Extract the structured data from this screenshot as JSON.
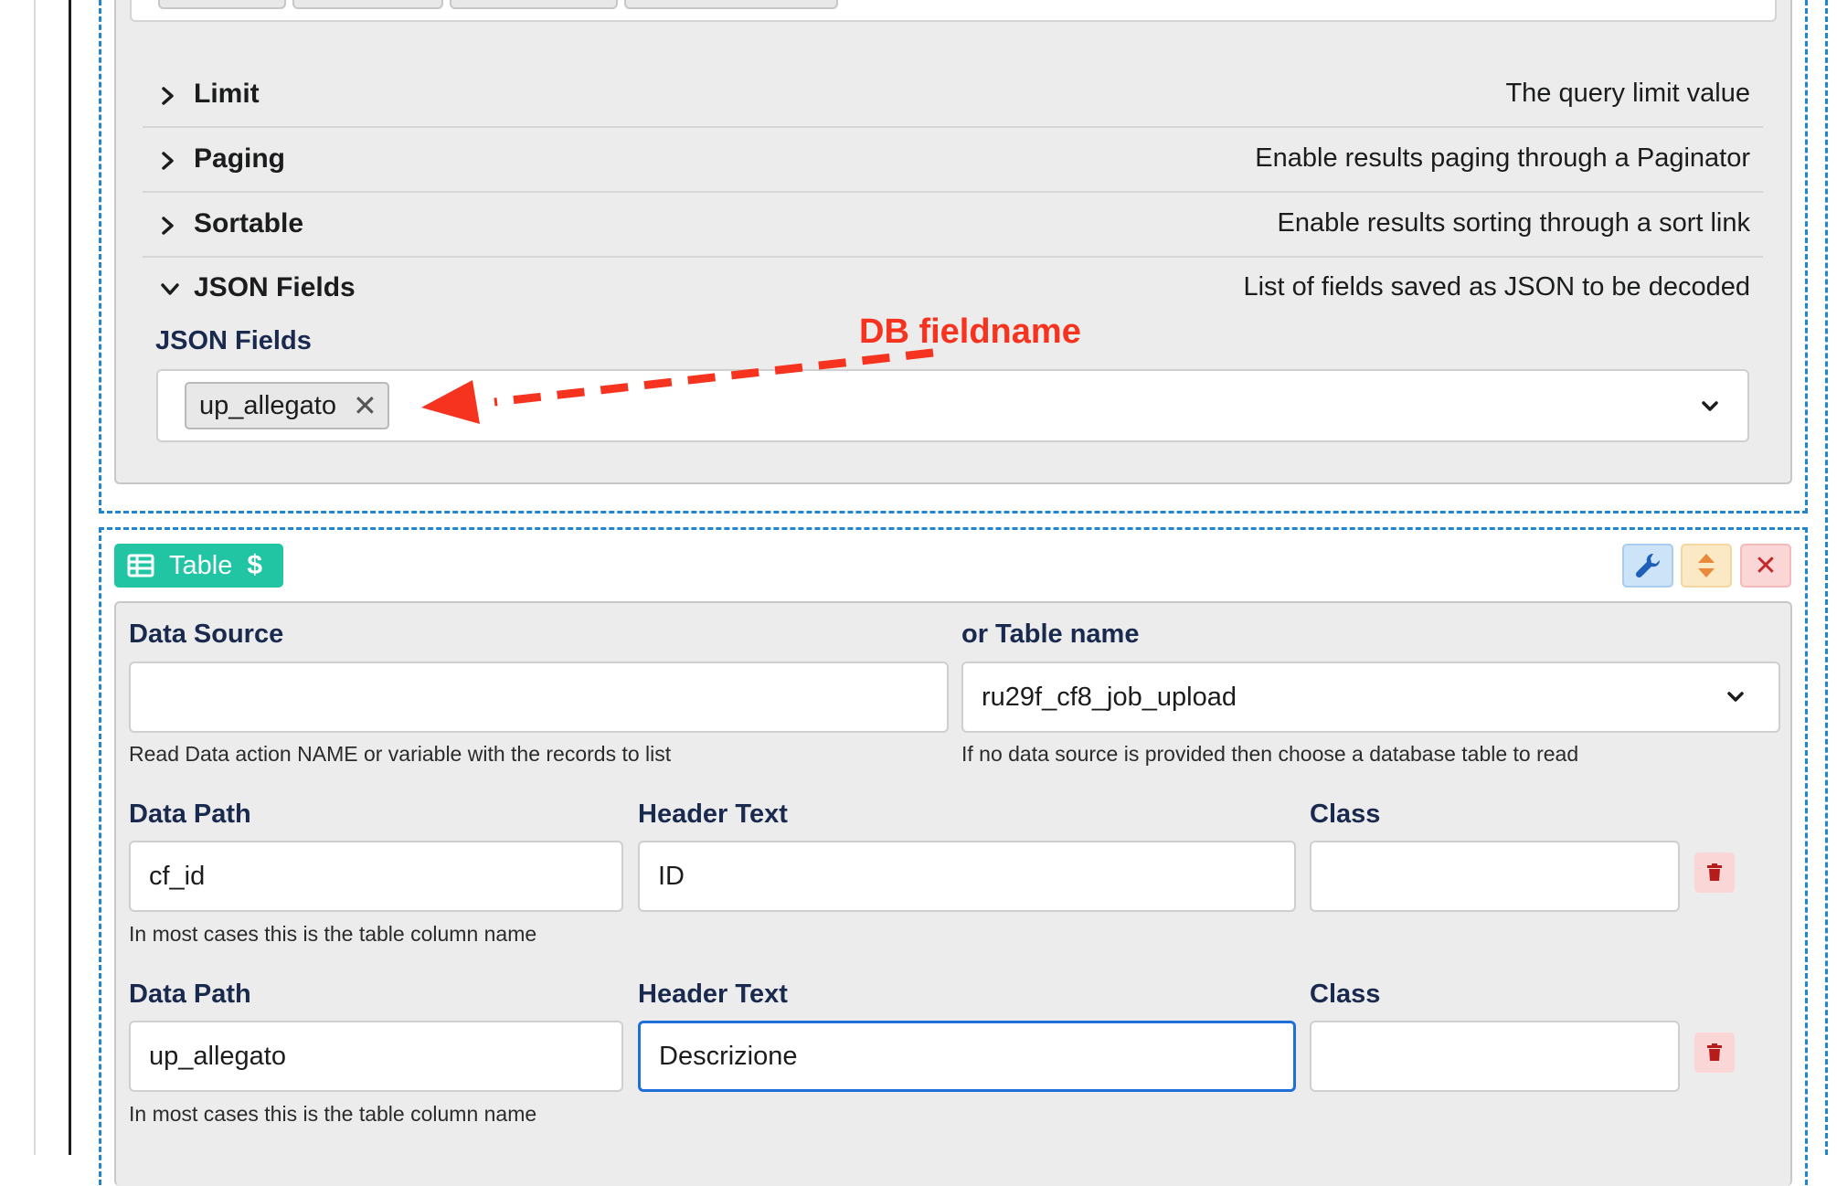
{
  "accordion": [
    {
      "title": "Limit",
      "description": "The query limit value",
      "state": "collapsed"
    },
    {
      "title": "Paging",
      "description": "Enable results paging through a Paginator",
      "state": "collapsed"
    },
    {
      "title": "Sortable",
      "description": "Enable results sorting through a sort link",
      "state": "collapsed"
    },
    {
      "title": "JSON Fields",
      "description": "List of fields saved as JSON to be decoded",
      "state": "expanded"
    }
  ],
  "json_fields": {
    "label": "JSON Fields",
    "chip": "up_allegato",
    "chip_remove_symbol": "✕"
  },
  "annotation": {
    "text": "DB fieldname",
    "color": "#f5331e"
  },
  "table_component": {
    "tag_label": "Table",
    "tag_symbol": "$",
    "close_symbol": "✕",
    "tag_color": "#21c5a4",
    "data_source": {
      "label": "Data Source",
      "value": "",
      "hint": "Read Data action NAME or variable with the records to list"
    },
    "table_name": {
      "label": "or Table name",
      "value": "ru29f_cf8_job_upload",
      "hint": "If no data source is provided then choose a database table to read"
    },
    "columns": [
      {
        "data_path_label": "Data Path",
        "data_path": "cf_id",
        "header_label": "Header Text",
        "header": "ID",
        "class_label": "Class",
        "class": "",
        "hint": "In most cases this is the table column name"
      },
      {
        "data_path_label": "Data Path",
        "data_path": "up_allegato",
        "header_label": "Header Text",
        "header": "Descrizione",
        "class_label": "Class",
        "class": "",
        "hint": "In most cases this is the table column name"
      }
    ]
  },
  "colors": {
    "label_navy": "#1a2a4e",
    "focus_blue": "#1e6fd9",
    "dash_blue": "#2185d0",
    "panel_gray": "#ececec"
  }
}
